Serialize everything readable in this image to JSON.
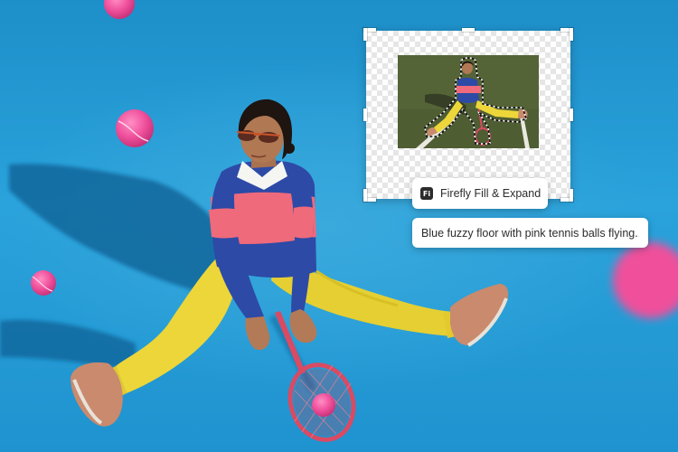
{
  "feature": {
    "logo_text": "Fi",
    "label": "Firefly Fill & Expand"
  },
  "prompt": {
    "text": "Blue fuzzy floor with pink tennis balls flying..."
  },
  "colors": {
    "floor_blue": "#1f93cf",
    "ball_pink": "#ef4f9b",
    "sweater_blue": "#2d4aa6",
    "sweater_pink": "#ef6a7a",
    "pants_yellow": "#ecd63a",
    "panel_white": "#ffffff"
  },
  "icons": {
    "logo": "firefly-logo-icon"
  }
}
